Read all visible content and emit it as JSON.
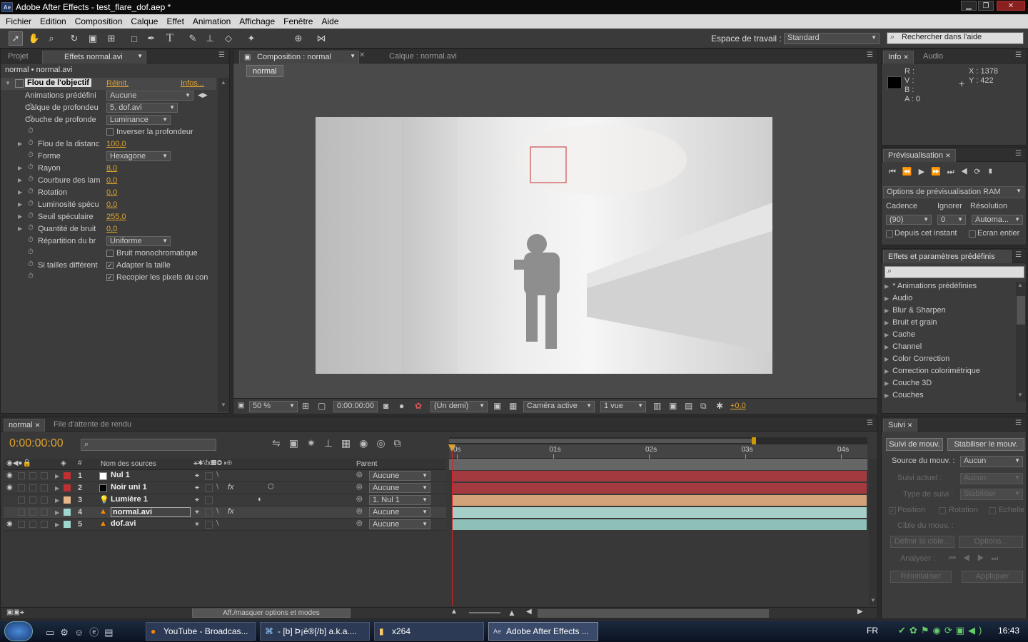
{
  "window": {
    "title": "Adobe After Effects - test_flare_dof.aep *",
    "min": "▁",
    "max": "❐",
    "close": "✕",
    "app_icon": "Ae"
  },
  "menu": [
    "Fichier",
    "Edition",
    "Composition",
    "Calque",
    "Effet",
    "Animation",
    "Affichage",
    "Fenêtre",
    "Aide"
  ],
  "toolbar": {
    "workspace_label": "Espace de travail :",
    "workspace_value": "Standard",
    "help_placeholder": "Rechercher dans l'aide"
  },
  "effects_panel": {
    "tab_project": "Projet",
    "tab_effects": "Effets normal.avi",
    "path": "normal • normal.avi",
    "effect_name": "Flou de l'objectif",
    "reset": "Réinit.",
    "about": "Infos...",
    "rows": [
      {
        "label": "Animations prédéfini",
        "type": "dropdown",
        "value": "Aucune"
      },
      {
        "label": "Calque de profondeu",
        "type": "dropdown",
        "value": "5. dof.avi"
      },
      {
        "label": "Couche de profonde",
        "type": "dropdown",
        "value": "Luminance"
      },
      {
        "label": "",
        "type": "check",
        "value": "Inverser la profondeur",
        "checked": false
      },
      {
        "label": "Flou de la distanc",
        "type": "num",
        "value": "100,0"
      },
      {
        "label": "Forme",
        "type": "dropdown",
        "value": "Hexagone"
      },
      {
        "label": "Rayon",
        "type": "num",
        "value": "8,0"
      },
      {
        "label": "Courbure des lam",
        "type": "num",
        "value": "0,0"
      },
      {
        "label": "Rotation",
        "type": "num",
        "value": "0,0"
      },
      {
        "label": "Luminosité spécu",
        "type": "num",
        "value": "0,0"
      },
      {
        "label": "Seuil spéculaire",
        "type": "num",
        "value": "255,0"
      },
      {
        "label": "Quantité de bruit",
        "type": "num",
        "value": "0,0"
      },
      {
        "label": "Répartition du br",
        "type": "dropdown",
        "value": "Uniforme"
      },
      {
        "label": "",
        "type": "check",
        "value": "Bruit monochromatique",
        "checked": false
      },
      {
        "label": "Si tailles différent",
        "type": "check",
        "value": "Adapter la taille",
        "checked": true
      },
      {
        "label": "",
        "type": "check",
        "value": "Recopier les pixels du con",
        "checked": true
      }
    ]
  },
  "comp_panel": {
    "tab_comp": "Composition : normal",
    "tab_layer": "Calque : normal.avi",
    "flow_tab": "normal",
    "zoom": "50 %",
    "timecode": "0:00:00:00",
    "resolution": "(Un demi)",
    "camera": "Caméra active",
    "views": "1 vue",
    "exposure": "+0,0"
  },
  "info_panel": {
    "tab_info": "Info",
    "tab_audio": "Audio",
    "r": "R :",
    "v": "V :",
    "b": "B :",
    "a": "A : 0",
    "x": "X : 1378",
    "y": "Y : 422"
  },
  "preview_panel": {
    "title": "Prévisualisation",
    "ram_options": "Options de prévisualisation RAM",
    "cadence_label": "Cadence",
    "ignore_label": "Ignorer",
    "resolution_label": "Résolution",
    "cadence": "(90)",
    "ignore": "0",
    "resolution": "Automa...",
    "from_now": "Depuis cet instant",
    "full_screen": "Ecran entier"
  },
  "effects_presets": {
    "title": "Effets et paramètres prédéfinis",
    "items": [
      "* Animations prédéfinies",
      "Audio",
      "Blur & Sharpen",
      "Bruit et grain",
      "Cache",
      "Channel",
      "Color Correction",
      "Correction colorimétrique",
      "Couche 3D",
      "Couches"
    ]
  },
  "timeline": {
    "tab_comp": "normal",
    "tab_render": "File d'attente de rendu",
    "timecode": "0:00:00:00",
    "col_sources": "Nom des sources",
    "col_parent": "Parent",
    "col_num": "#",
    "ruler": [
      "0s",
      "01s",
      "02s",
      "03s",
      "04s"
    ],
    "layers": [
      {
        "num": "1",
        "name": "Nul 1",
        "label_color": "#c03030",
        "swatch": "#ffffff",
        "parent": "Aucune",
        "bar_color": "#a33a40",
        "visible": true
      },
      {
        "num": "2",
        "name": "Noir uni 1",
        "label_color": "#c03030",
        "swatch": "#000000",
        "parent": "Aucune",
        "bar_color": "#a33a40",
        "visible": true
      },
      {
        "num": "3",
        "name": "Lumière 1",
        "label_color": "#e8b888",
        "swatch": "",
        "parent": "1. Nul 1",
        "bar_color": "#d4a27a",
        "visible": false
      },
      {
        "num": "4",
        "name": "normal.avi",
        "label_color": "#9fd6d0",
        "swatch": "",
        "parent": "Aucune",
        "bar_color": "#a6cfc9",
        "visible": false
      },
      {
        "num": "5",
        "name": "dof.avi",
        "label_color": "#9fd6d0",
        "swatch": "",
        "parent": "Aucune",
        "bar_color": "#8fc0b8",
        "visible": true
      }
    ],
    "toggle_modes": "Aff./masquer options et modes"
  },
  "tracker": {
    "title": "Suivi",
    "track_motion": "Suivi de mouv.",
    "stabilize": "Stabiliser le mouv.",
    "source_label": "Source du mouv. :",
    "source_value": "Aucun",
    "current_label": "Suivi actuel :",
    "current_value": "Aucun",
    "type_label": "Type de suivi :",
    "type_value": "Stabiliser",
    "position": "Position",
    "rotation": "Rotation",
    "scale": "Echelle",
    "target": "Cible du mouv. :",
    "define_target": "Définir la cible...",
    "options": "Options...",
    "analyze": "Analyser :",
    "reset": "Réinitialiser",
    "apply": "Appliquer"
  },
  "taskbar": {
    "items": [
      "YouTube - Broadcas...",
      "- [b] Þ¡ë®[/b] a.k.a....",
      "x264",
      "Adobe After Effects ..."
    ],
    "lang": "FR",
    "clock": "16:43"
  }
}
